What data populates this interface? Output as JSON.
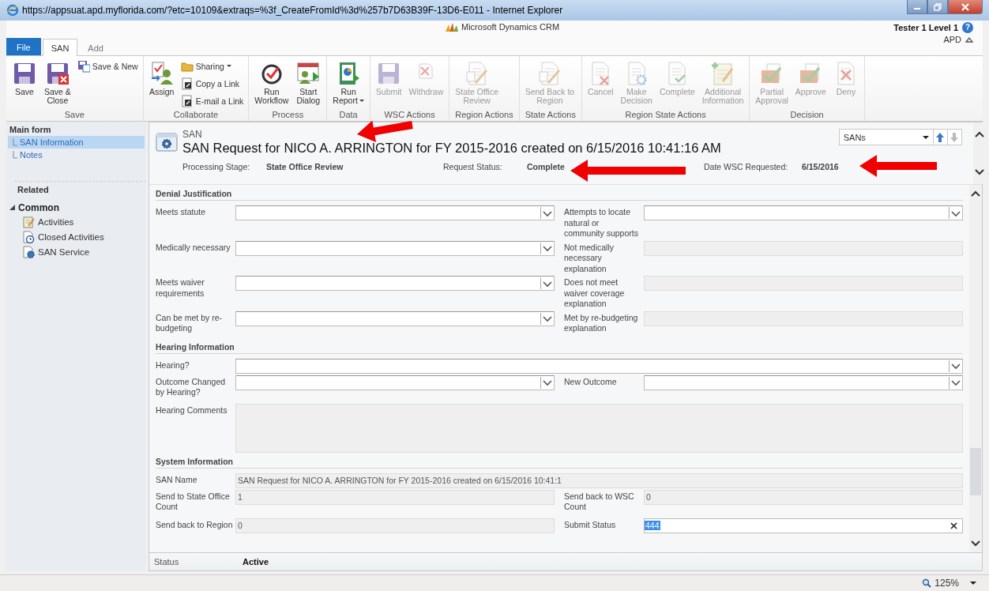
{
  "window": {
    "title": "https://appsuat.apd.myflorida.com/?etc=10109&extraqs=%3f_CreateFromId%3d%257b7D63B39F-13D6-E011 - Internet Explorer"
  },
  "app": {
    "product": "Microsoft Dynamics CRM",
    "user": "Tester 1 Level 1",
    "help": "?",
    "org": "APD"
  },
  "tabs": [
    {
      "label": "File",
      "kind": "file",
      "selected": false
    },
    {
      "label": "SAN",
      "kind": "tab",
      "selected": true
    },
    {
      "label": "Add",
      "kind": "tab",
      "selected": false
    }
  ],
  "ribbon": [
    {
      "label": "Save",
      "buttons": [
        {
          "label": "Save",
          "kind": "large",
          "disabled": false,
          "dropdown": false
        },
        {
          "label": "Save &\nClose",
          "kind": "large",
          "disabled": false,
          "dropdown": false
        },
        {
          "label": "Save & New",
          "kind": "small",
          "disabled": false,
          "dropdown": false
        }
      ]
    },
    {
      "label": "Collaborate",
      "buttons": [
        {
          "label": "Assign",
          "kind": "large",
          "disabled": false,
          "dropdown": false
        },
        {
          "label": "Sharing",
          "kind": "small",
          "disabled": false,
          "dropdown": true
        },
        {
          "label": "Copy a Link",
          "kind": "small",
          "disabled": false,
          "dropdown": false
        },
        {
          "label": "E-mail a Link",
          "kind": "small",
          "disabled": false,
          "dropdown": false
        }
      ]
    },
    {
      "label": "Process",
      "buttons": [
        {
          "label": "Run\nWorkflow",
          "kind": "large",
          "disabled": false,
          "dropdown": false
        },
        {
          "label": "Start\nDialog",
          "kind": "large",
          "disabled": false,
          "dropdown": false
        }
      ]
    },
    {
      "label": "Data",
      "buttons": [
        {
          "label": "Run\nReport",
          "kind": "large",
          "disabled": false,
          "dropdown": true
        }
      ]
    },
    {
      "label": "WSC Actions",
      "buttons": [
        {
          "label": "Submit",
          "kind": "large",
          "disabled": true,
          "dropdown": false
        },
        {
          "label": "Withdraw",
          "kind": "large",
          "disabled": true,
          "dropdown": false
        }
      ]
    },
    {
      "label": "Region Actions",
      "buttons": [
        {
          "label": "State Office\nReview",
          "kind": "large",
          "disabled": true,
          "dropdown": false
        }
      ]
    },
    {
      "label": "State Actions",
      "buttons": [
        {
          "label": "Send Back to\nRegion",
          "kind": "large",
          "disabled": true,
          "dropdown": false
        }
      ]
    },
    {
      "label": "Region State Actions",
      "buttons": [
        {
          "label": "Cancel",
          "kind": "large",
          "disabled": true,
          "dropdown": false
        },
        {
          "label": "Make\nDecision",
          "kind": "large",
          "disabled": true,
          "dropdown": false
        },
        {
          "label": "Complete",
          "kind": "large",
          "disabled": true,
          "dropdown": false
        },
        {
          "label": "Additional\nInformation",
          "kind": "large",
          "disabled": true,
          "dropdown": false
        }
      ]
    },
    {
      "label": "Decision",
      "buttons": [
        {
          "label": "Partial\nApproval",
          "kind": "large",
          "disabled": true,
          "dropdown": false
        },
        {
          "label": "Approve",
          "kind": "large",
          "disabled": true,
          "dropdown": false
        },
        {
          "label": "Deny",
          "kind": "large",
          "disabled": true,
          "dropdown": false
        }
      ]
    }
  ],
  "nav": {
    "form_heading": "Main form",
    "form_items": [
      {
        "label": "SAN Information",
        "selected": true
      },
      {
        "label": "Notes",
        "selected": false
      }
    ],
    "related_heading": "Related",
    "group": {
      "label": "Common",
      "expanded": true,
      "items": [
        {
          "label": "Activities"
        },
        {
          "label": "Closed Activities"
        },
        {
          "label": "SAN Service"
        }
      ]
    }
  },
  "header": {
    "entity": "SAN",
    "title": "SAN Request for NICO A. ARRINGTON for FY 2015-2016 created on 6/15/2016 10:41:16 AM",
    "fields": [
      {
        "label": "Processing Stage:",
        "value": "State Office Review"
      },
      {
        "label": "Request Status:",
        "value": "Complete"
      },
      {
        "label": "Date WSC Requested:",
        "value": "6/15/2016"
      }
    ],
    "record_nav": {
      "view": "SANs",
      "up_disabled": false,
      "down_disabled": true
    }
  },
  "sections": [
    {
      "title": "Denial Justification",
      "rows": [
        [
          {
            "label": "Meets statute",
            "kind": "select",
            "disabled": false
          },
          {
            "label": "Attempts to locate natural or community supports",
            "kind": "select",
            "disabled": false
          }
        ],
        [
          {
            "label": "Medically necessary",
            "kind": "select",
            "disabled": false
          },
          {
            "label": "Not medically necessary explanation",
            "kind": "text",
            "disabled": true
          }
        ],
        [
          {
            "label": "Meets waiver requirements",
            "kind": "select",
            "disabled": false
          },
          {
            "label": "Does not meet waiver coverage explanation",
            "kind": "text",
            "disabled": true
          }
        ],
        [
          {
            "label": "Can be met by re-budgeting",
            "kind": "select",
            "disabled": false
          },
          {
            "label": "Met by re-budgeting explanation",
            "kind": "text",
            "disabled": true
          }
        ]
      ]
    },
    {
      "title": "Hearing Information",
      "rows": [
        [
          {
            "label": "Hearing?",
            "kind": "select",
            "disabled": false
          }
        ],
        [
          {
            "label": "Outcome Changed by Hearing?",
            "kind": "select",
            "disabled": false
          },
          {
            "label": "New Outcome",
            "kind": "select",
            "disabled": false
          }
        ],
        [
          {
            "label": "Hearing Comments",
            "kind": "textarea",
            "disabled": true
          }
        ]
      ]
    },
    {
      "title": "System Information",
      "rows": [
        [
          {
            "label": "SAN Name",
            "kind": "text",
            "disabled": true,
            "value": "SAN Request for NICO A. ARRINGTON for FY 2015-2016 created on 6/15/2016 10:41:1"
          }
        ],
        [
          {
            "label": "Send to State Office Count",
            "kind": "text",
            "disabled": true,
            "value": "1"
          },
          {
            "label": "Send back to WSC Count",
            "kind": "text",
            "disabled": true,
            "value": "0"
          }
        ],
        [
          {
            "label": "Send back to Region",
            "kind": "text",
            "disabled": true,
            "value": "0"
          },
          {
            "label": "Submit Status",
            "kind": "text",
            "disabled": false,
            "value": "444",
            "highlighted": true,
            "clearable": true
          }
        ]
      ]
    }
  ],
  "footer": {
    "label": "Status",
    "value": "Active"
  },
  "status_bar": {
    "zoom": "125%"
  }
}
